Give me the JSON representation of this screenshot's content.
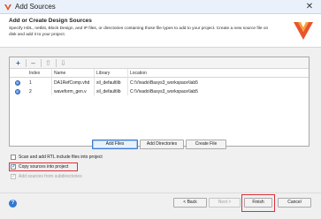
{
  "window": {
    "title": "Add Sources",
    "close_icon": "close-icon"
  },
  "header": {
    "title": "Add or Create Design Sources",
    "description": "Specify HDL, netlist, Block Design, and IP files, or directories containing those file types to add to your project. Create a new source file on disk and add it to your project."
  },
  "toolbar": {
    "add": "+",
    "remove": "–",
    "move_up": "⇧",
    "move_down": "⇩"
  },
  "table": {
    "headers": [
      "Index",
      "Name",
      "Library",
      "Location"
    ],
    "rows": [
      {
        "index": "1",
        "name": "DA1RefComp.vhd",
        "library": "xil_defaultlib",
        "location": "C:\\Vivado\\Basys3_workspace\\lab5"
      },
      {
        "index": "2",
        "name": "waveform_gen.v",
        "library": "xil_defaultlib",
        "location": "C:\\Vivado\\Basys3_workspace\\lab5"
      }
    ]
  },
  "buttons": {
    "add_files": "Add Files",
    "add_directories": "Add Directories",
    "create_file": "Create File"
  },
  "options": {
    "scan_rtl": {
      "label": "Scan and add RTL include files into project",
      "checked": false
    },
    "copy_sources": {
      "label": "Copy sources into project",
      "checked": true
    },
    "subdirectories": {
      "label": "Add sources from subdirectories",
      "checked": true,
      "disabled": true
    }
  },
  "footer": {
    "help": "?",
    "back": "< Back",
    "next": "Next >",
    "finish": "Finish",
    "cancel": "Cancel"
  },
  "colors": {
    "accent": "#3d7bd1",
    "highlight": "#d9313a"
  }
}
